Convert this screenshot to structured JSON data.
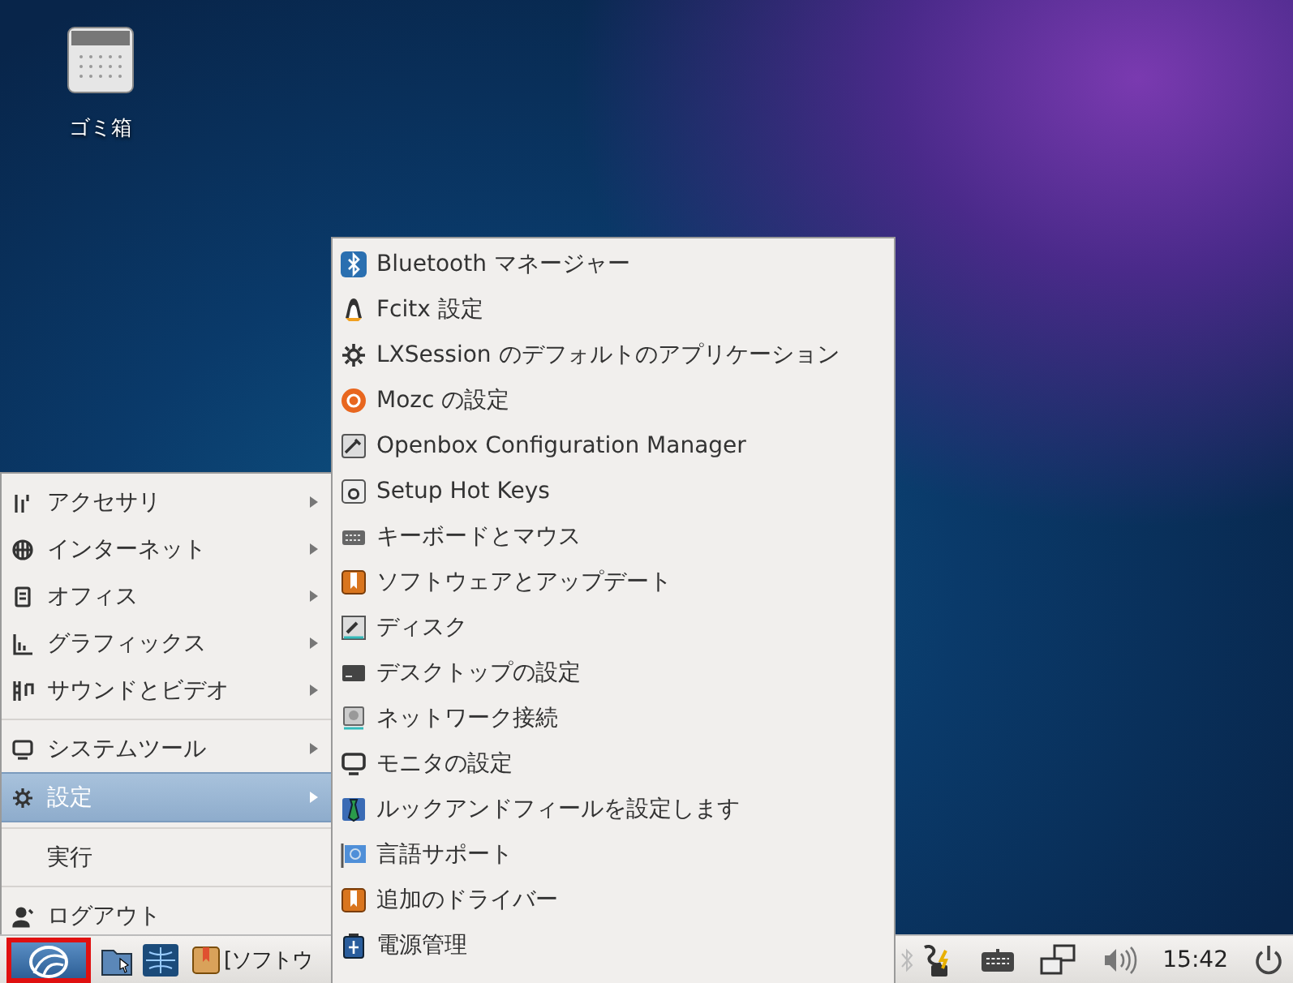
{
  "desktop": {
    "icons": [
      {
        "label": "ゴミ箱"
      }
    ]
  },
  "main_menu": {
    "groups": [
      [
        {
          "label": "アクセサリ",
          "has_submenu": true,
          "selected": false
        },
        {
          "label": "インターネット",
          "has_submenu": true,
          "selected": false
        },
        {
          "label": "オフィス",
          "has_submenu": true,
          "selected": false
        },
        {
          "label": "グラフィックス",
          "has_submenu": true,
          "selected": false
        },
        {
          "label": "サウンドとビデオ",
          "has_submenu": true,
          "selected": false
        }
      ],
      [
        {
          "label": "システムツール",
          "has_submenu": true,
          "selected": false
        },
        {
          "label": "設定",
          "has_submenu": true,
          "selected": true
        }
      ],
      [
        {
          "label": "実行",
          "has_submenu": false,
          "selected": false
        }
      ],
      [
        {
          "label": "ログアウト",
          "has_submenu": false,
          "selected": false
        }
      ]
    ]
  },
  "submenu": {
    "items": [
      {
        "label": "Bluetooth マネージャー",
        "selected": false
      },
      {
        "label": "Fcitx 設定",
        "selected": false
      },
      {
        "label": "LXSession のデフォルトのアプリケーション",
        "selected": false
      },
      {
        "label": "Mozc の設定",
        "selected": false
      },
      {
        "label": "Openbox Configuration Manager",
        "selected": false
      },
      {
        "label": "Setup Hot Keys",
        "selected": false
      },
      {
        "label": "キーボードとマウス",
        "selected": false
      },
      {
        "label": "ソフトウェアとアップデート",
        "selected": false
      },
      {
        "label": "ディスク",
        "selected": false
      },
      {
        "label": "デスクトップの設定",
        "selected": false
      },
      {
        "label": "ネットワーク接続",
        "selected": false
      },
      {
        "label": "モニタの設定",
        "selected": false
      },
      {
        "label": "ルックアンドフィールを設定します",
        "selected": false
      },
      {
        "label": "言語サポート",
        "selected": false
      },
      {
        "label": "追加のドライバー",
        "selected": false
      },
      {
        "label": "電源管理",
        "selected": false
      }
    ]
  },
  "taskbar": {
    "start_highlighted": true,
    "tasks": [
      {
        "label": "[ソフトウ"
      }
    ],
    "clock": "15:42"
  }
}
